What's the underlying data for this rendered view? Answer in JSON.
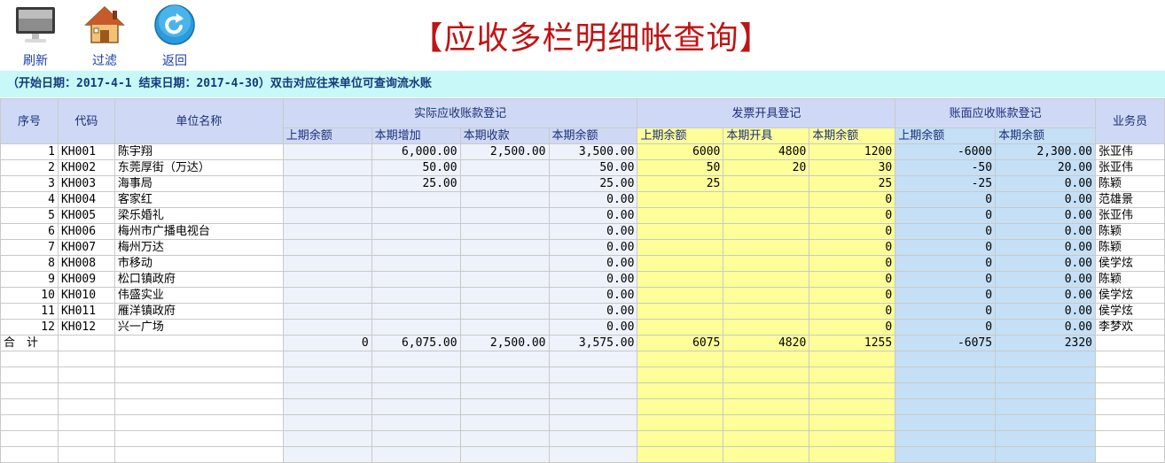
{
  "toolbar": {
    "refresh_label": "刷新",
    "filter_label": "过滤",
    "back_label": "返回"
  },
  "title": "【应收多栏明细帐查询】",
  "info_bar": "（开始日期：2017-4-1  结束日期：2017-4-30）双击对应往来单位可查询流水账",
  "headers": {
    "seq": "序号",
    "code": "代码",
    "unit": "单位名称",
    "group_actual": "实际应收账款登记",
    "group_invoice": "发票开具登记",
    "group_book": "账面应收账款登记",
    "salesman": "业务员",
    "actual_prev": "上期余额",
    "actual_increase": "本期增加",
    "actual_received": "本期收款",
    "actual_balance": "本期余额",
    "inv_prev": "上期余额",
    "inv_issued": "本期开具",
    "inv_balance": "本期余额",
    "book_prev": "上期余额",
    "book_balance": "本期余额"
  },
  "rows": [
    {
      "seq": "1",
      "code": "KH001",
      "unit": "陈宇翔",
      "a_prev": "",
      "a_inc": "6,000.00",
      "a_rec": "2,500.00",
      "a_bal": "3,500.00",
      "i_prev": "6000",
      "i_iss": "4800",
      "i_bal": "1200",
      "b_prev": "-6000",
      "b_bal": "2,300.00",
      "sales": "张亚伟"
    },
    {
      "seq": "2",
      "code": "KH002",
      "unit": "东莞厚街（万达）",
      "a_prev": "",
      "a_inc": "50.00",
      "a_rec": "",
      "a_bal": "50.00",
      "i_prev": "50",
      "i_iss": "20",
      "i_bal": "30",
      "b_prev": "-50",
      "b_bal": "20.00",
      "sales": "张亚伟"
    },
    {
      "seq": "3",
      "code": "KH003",
      "unit": "海事局",
      "a_prev": "",
      "a_inc": "25.00",
      "a_rec": "",
      "a_bal": "25.00",
      "i_prev": "25",
      "i_iss": "",
      "i_bal": "25",
      "b_prev": "-25",
      "b_bal": "0.00",
      "sales": "陈颖"
    },
    {
      "seq": "4",
      "code": "KH004",
      "unit": "客家红",
      "a_prev": "",
      "a_inc": "",
      "a_rec": "",
      "a_bal": "0.00",
      "i_prev": "",
      "i_iss": "",
      "i_bal": "0",
      "b_prev": "0",
      "b_bal": "0.00",
      "sales": "范雄景"
    },
    {
      "seq": "5",
      "code": "KH005",
      "unit": "梁乐婚礼",
      "a_prev": "",
      "a_inc": "",
      "a_rec": "",
      "a_bal": "0.00",
      "i_prev": "",
      "i_iss": "",
      "i_bal": "0",
      "b_prev": "0",
      "b_bal": "0.00",
      "sales": "张亚伟"
    },
    {
      "seq": "6",
      "code": "KH006",
      "unit": "梅州市广播电视台",
      "a_prev": "",
      "a_inc": "",
      "a_rec": "",
      "a_bal": "0.00",
      "i_prev": "",
      "i_iss": "",
      "i_bal": "0",
      "b_prev": "0",
      "b_bal": "0.00",
      "sales": "陈颖"
    },
    {
      "seq": "7",
      "code": "KH007",
      "unit": "梅州万达",
      "a_prev": "",
      "a_inc": "",
      "a_rec": "",
      "a_bal": "0.00",
      "i_prev": "",
      "i_iss": "",
      "i_bal": "0",
      "b_prev": "0",
      "b_bal": "0.00",
      "sales": "陈颖"
    },
    {
      "seq": "8",
      "code": "KH008",
      "unit": "市移动",
      "a_prev": "",
      "a_inc": "",
      "a_rec": "",
      "a_bal": "0.00",
      "i_prev": "",
      "i_iss": "",
      "i_bal": "0",
      "b_prev": "0",
      "b_bal": "0.00",
      "sales": "侯学炫"
    },
    {
      "seq": "9",
      "code": "KH009",
      "unit": "松口镇政府",
      "a_prev": "",
      "a_inc": "",
      "a_rec": "",
      "a_bal": "0.00",
      "i_prev": "",
      "i_iss": "",
      "i_bal": "0",
      "b_prev": "0",
      "b_bal": "0.00",
      "sales": "陈颖"
    },
    {
      "seq": "10",
      "code": "KH010",
      "unit": "伟盛实业",
      "a_prev": "",
      "a_inc": "",
      "a_rec": "",
      "a_bal": "0.00",
      "i_prev": "",
      "i_iss": "",
      "i_bal": "0",
      "b_prev": "0",
      "b_bal": "0.00",
      "sales": "侯学炫"
    },
    {
      "seq": "11",
      "code": "KH011",
      "unit": "雁洋镇政府",
      "a_prev": "",
      "a_inc": "",
      "a_rec": "",
      "a_bal": "0.00",
      "i_prev": "",
      "i_iss": "",
      "i_bal": "0",
      "b_prev": "0",
      "b_bal": "0.00",
      "sales": "侯学炫"
    },
    {
      "seq": "12",
      "code": "KH012",
      "unit": "兴一广场",
      "a_prev": "",
      "a_inc": "",
      "a_rec": "",
      "a_bal": "0.00",
      "i_prev": "",
      "i_iss": "",
      "i_bal": "0",
      "b_prev": "0",
      "b_bal": "0.00",
      "sales": "李梦欢"
    }
  ],
  "total": {
    "label": "合　计",
    "a_prev": "0",
    "a_inc": "6,075.00",
    "a_rec": "2,500.00",
    "a_bal": "3,575.00",
    "i_prev": "6075",
    "i_iss": "4820",
    "i_bal": "1255",
    "b_prev": "-6075",
    "b_bal": "2320"
  },
  "colors": {
    "title": "#c01414",
    "info_bar_bg": "#c8f8f8",
    "header_bg": "#cfd9f5",
    "invoice_bg": "#ffff99",
    "book_bg": "#c5dff6",
    "toolbar_label": "#1a3fa8"
  },
  "icons": [
    "monitor-icon",
    "house-icon",
    "back-arrow-icon"
  ]
}
